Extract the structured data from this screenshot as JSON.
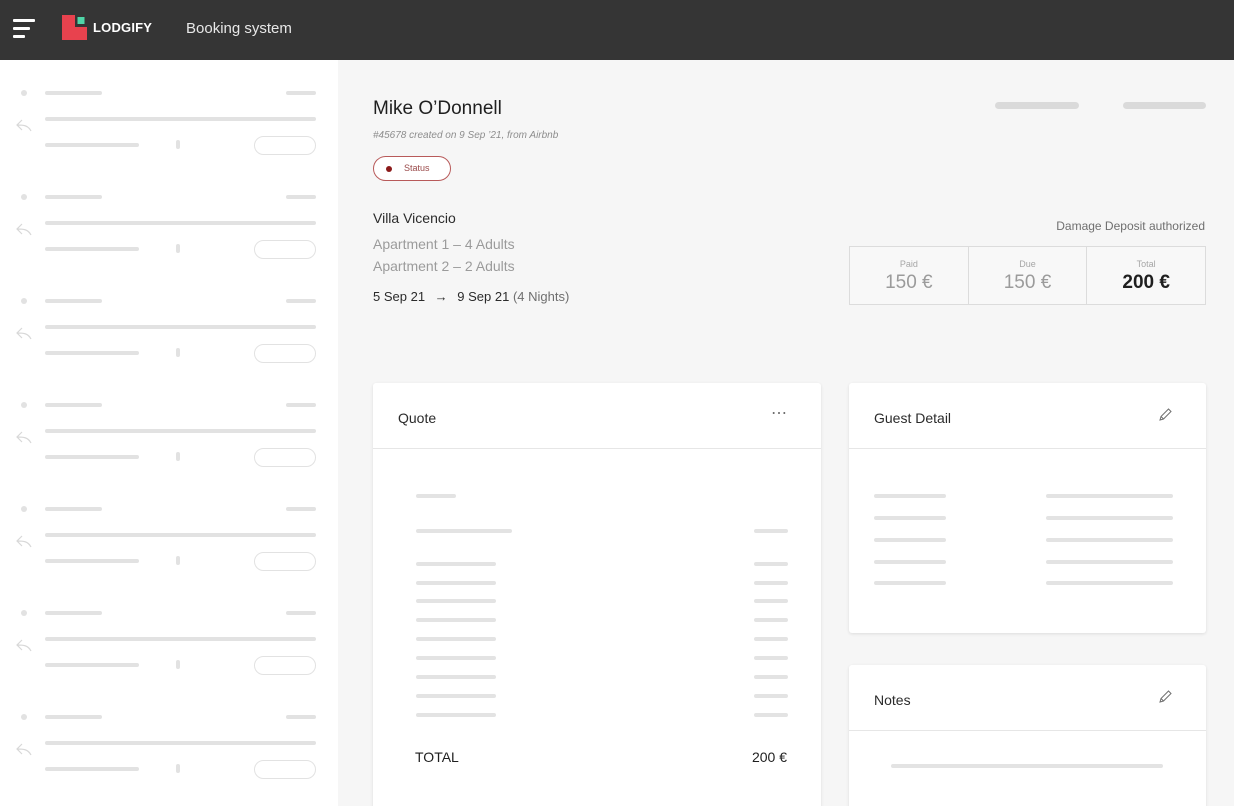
{
  "topbar": {
    "logo_text": "LODGIFY",
    "app_title": "Booking system",
    "accent_color": "#e8424e"
  },
  "booking": {
    "guest_name": "Mike O’Donnell",
    "meta": "#45678 created on 9 Sep ’21, from Airbnb",
    "status_label": "Status",
    "status_color": "#8b1a1a",
    "property": "Villa Vicencio",
    "units": [
      "Apartment 1 – 4 Adults",
      "Apartment 2 – 2 Adults"
    ],
    "check_in": "5 Sep 21",
    "arrow": "→",
    "check_out": "9 Sep 21",
    "nights": "(4 Nights)",
    "deposit_status": "Damage Deposit authorized"
  },
  "payment": {
    "paid_label": "Paid",
    "paid_value": "150 €",
    "due_label": "Due",
    "due_value": "150 €",
    "total_label": "Total",
    "total_value": "200 €"
  },
  "quote": {
    "title": "Quote",
    "menu_icon": "more-horizontal-icon",
    "total_label": "TOTAL",
    "total_value": "200 €"
  },
  "guest_detail": {
    "title": "Guest Detail",
    "edit_icon": "pencil-icon"
  },
  "notes": {
    "title": "Notes",
    "edit_icon": "pencil-icon"
  },
  "sidebar": {
    "reply_icon": "reply-icon"
  }
}
